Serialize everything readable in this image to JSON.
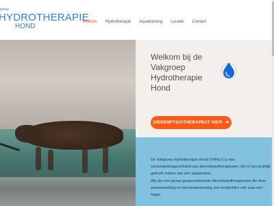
{
  "logo": {
    "small": "groep",
    "main": "HYDROTHERAPIE",
    "sub": "HOND"
  },
  "nav": {
    "items": [
      {
        "label": "Welkom"
      },
      {
        "label": "Hydrotherapie"
      },
      {
        "label": "Aquatraining"
      },
      {
        "label": "Locatie"
      },
      {
        "label": "Contact"
      }
    ],
    "active_color": "#e5561e"
  },
  "hero": {
    "title_line1": "Welkom bij de",
    "title_line2": "Vakgroep",
    "title_line3": "Hydrotherapie",
    "title_line4": "Hond",
    "photo_icon": "dog-in-water-treadmill",
    "drop_icon": "water-drop-icon"
  },
  "cta": {
    "label": "DIERENFYSIOTHERAPEUT HIER",
    "arrow_icon": "arrow-right-icon",
    "color": "#ff5a14"
  },
  "info": {
    "paragraph1": "De Vakgroep Hydrotherapie Hond (VHH) © is een samenwerkingsverband van dierenfysiotherapeuten, die in hun praktijk gebruik maken van een aquatrainer.",
    "paragraph2": "Wij zijn een groep gespecialiseerde dierenfysiotherapeuten die door samenwerking en kennisuitwisseling ons verplichten ook naar een hoger",
    "background_color": "#82c2e0"
  }
}
